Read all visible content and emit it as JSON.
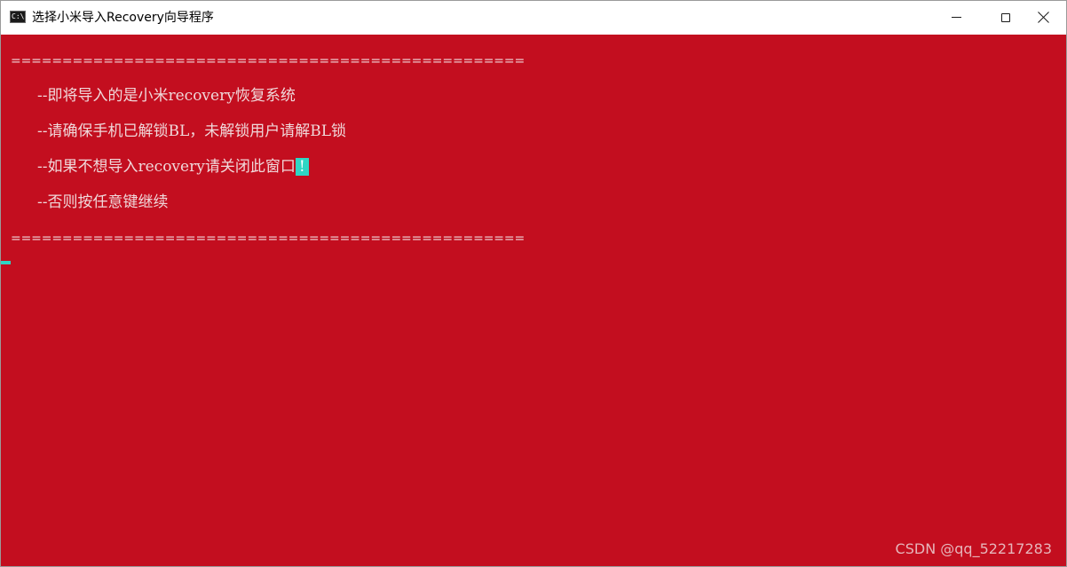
{
  "window": {
    "title": "选择小米导入Recovery向导程序",
    "icon": "cmd-console-icon",
    "icon_text": "C:\\",
    "controls": {
      "minimize": "minimize-icon",
      "maximize": "maximize-icon",
      "close": "close-icon"
    }
  },
  "console": {
    "background_color": "#c30e1f",
    "text_color": "#f0d8da",
    "separator_top": "==================================================",
    "lines": [
      "--即将导入的是小米recovery恢复系统",
      "--请确保手机已解锁BL，未解锁用户请解BL锁",
      "--如果不想导入recovery请关闭此窗口",
      "--否则按任意键继续"
    ],
    "highlight": "!",
    "highlight_color": "#2fd6c4",
    "separator_bottom": "=================================================="
  },
  "watermark": "CSDN @qq_52217283"
}
